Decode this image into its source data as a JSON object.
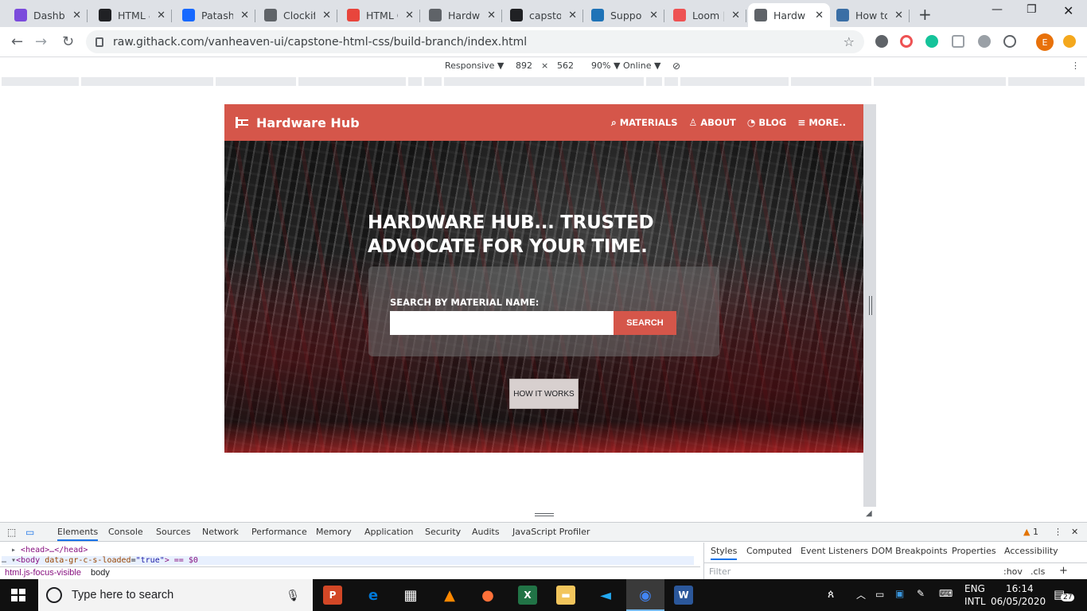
{
  "browser": {
    "tabs": [
      {
        "title": "Dashbo",
        "favicon_color": "#7b4bdc",
        "favicon_icon": "dashboard-icon"
      },
      {
        "title": "HTML &",
        "favicon_color": "#202124",
        "favicon_icon": "graduation-cap-icon"
      },
      {
        "title": "Patash",
        "favicon_color": "#1769ff",
        "favicon_icon": "behance-icon"
      },
      {
        "title": "Clockif",
        "favicon_color": "#5f6368",
        "favicon_icon": "clockify-icon"
      },
      {
        "title": "HTML C",
        "favicon_color": "#e8453c",
        "favicon_icon": "colorwheel-icon"
      },
      {
        "title": "Hardwa",
        "favicon_color": "#5f6368",
        "favicon_icon": "globe-icon"
      },
      {
        "title": "capsto",
        "favicon_color": "#202124",
        "favicon_icon": "github-icon"
      },
      {
        "title": "Suppor",
        "favicon_color": "#1f73b7",
        "favicon_icon": "zendesk-icon"
      },
      {
        "title": "Loom |",
        "favicon_color": "#ee5253",
        "favicon_icon": "loom-icon"
      },
      {
        "title": "Hardwa",
        "favicon_color": "#5f6368",
        "favicon_icon": "globe-icon",
        "active": true
      },
      {
        "title": "How to",
        "favicon_color": "#3a6ea5",
        "favicon_icon": "w3-icon"
      }
    ],
    "url": "raw.githack.com/vanheaven-ui/capstone-html-css/build-branch/index.html",
    "profile_initial": "E"
  },
  "device_toolbar": {
    "mode": "Responsive ▼",
    "width": "892",
    "times": "×",
    "height": "562",
    "zoom": "90% ▼",
    "throttle": "Online ▼"
  },
  "site": {
    "brand": "Hardware Hub",
    "nav": [
      {
        "label": "MATERIALS",
        "icon": "search-icon"
      },
      {
        "label": "ABOUT",
        "icon": "user-icon"
      },
      {
        "label": "BLOG",
        "icon": "rss-icon"
      },
      {
        "label": "MORE..",
        "icon": "menu-icon"
      }
    ],
    "hero_title": "HARDWARE  HUB... TRUSTED ADVOCATE FOR YOUR TIME.",
    "search_label": "SEARCH  BY  MATERIAL  NAME:",
    "search_value": "",
    "search_button": "SEARCH",
    "how_button": "HOW IT WORKS",
    "accent": "#d5564a"
  },
  "devtools": {
    "tabs": [
      "Elements",
      "Console",
      "Sources",
      "Network",
      "Performance",
      "Memory",
      "Application",
      "Security",
      "Audits",
      "JavaScript Profiler"
    ],
    "warnings": "1",
    "dom_line1": "<head>…</head>",
    "dom_line2_tag": "<body",
    "dom_line2_attr": "data-gr-c-s-loaded",
    "dom_line2_val": "\"true\"",
    "dom_line2_tail": "> == $0",
    "breadcrumbs": [
      "html.js-focus-visible",
      "body"
    ],
    "side_tabs": [
      "Styles",
      "Computed",
      "Event Listeners",
      "DOM Breakpoints",
      "Properties",
      "Accessibility"
    ],
    "filter_placeholder": "Filter",
    "hov": ":hov",
    "cls": ".cls"
  },
  "taskbar": {
    "search_placeholder": "Type here to search",
    "apps": [
      {
        "icon": "powerpoint-icon",
        "color": "#d24726",
        "glyph": "P"
      },
      {
        "icon": "edge-icon",
        "color": "#0078d7",
        "glyph": "e"
      },
      {
        "icon": "store-icon",
        "color": "#ffffff",
        "glyph": "▦"
      },
      {
        "icon": "vlc-icon",
        "color": "#ff8800",
        "glyph": "▲"
      },
      {
        "icon": "firefox-icon",
        "color": "#ff7139",
        "glyph": "●"
      },
      {
        "icon": "excel-icon",
        "color": "#217346",
        "glyph": "X"
      },
      {
        "icon": "file-explorer-icon",
        "color": "#f2c55c",
        "glyph": "▬"
      },
      {
        "icon": "vscode-icon",
        "color": "#23a9f2",
        "glyph": "◄"
      },
      {
        "icon": "chrome-icon",
        "color": "#4285f4",
        "glyph": "◉"
      },
      {
        "icon": "word-icon",
        "color": "#2b579a",
        "glyph": "W"
      }
    ],
    "lang": "ENG",
    "layout": "INTL",
    "time": "16:14",
    "date": "06/05/2020",
    "notifications": "27"
  }
}
